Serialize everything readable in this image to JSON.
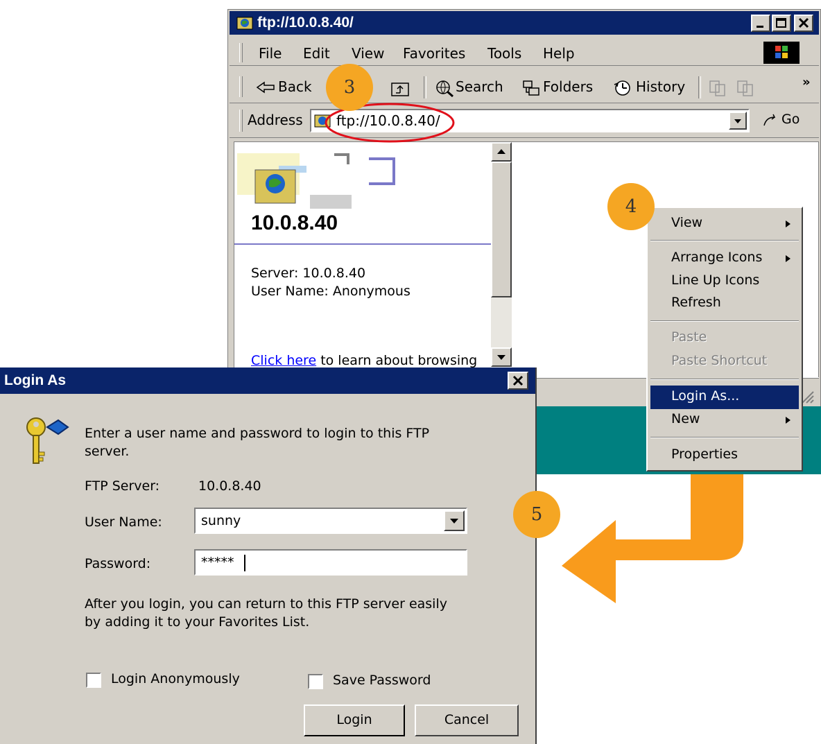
{
  "browser": {
    "title": "ftp://10.0.8.40/",
    "menu": [
      "File",
      "Edit",
      "View",
      "Favorites",
      "Tools",
      "Help"
    ],
    "toolbar": {
      "back": "Back",
      "search": "Search",
      "folders": "Folders",
      "history": "History",
      "more": "»"
    },
    "address": {
      "label": "Address",
      "value": "ftp://10.0.8.40/",
      "go": "Go"
    },
    "panel": {
      "host": "10.0.8.40",
      "server_line": "Server: 10.0.8.40",
      "user_line": "User Name: Anonymous",
      "link": "Click here",
      "link_rest": "to learn about browsing"
    }
  },
  "context_menu": {
    "items": [
      {
        "label": "View",
        "submenu": true,
        "disabled": false
      },
      {
        "label": "Arrange Icons",
        "submenu": true,
        "disabled": false
      },
      {
        "label": "Line Up Icons",
        "submenu": false,
        "disabled": false
      },
      {
        "label": "Refresh",
        "submenu": false,
        "disabled": false
      },
      {
        "label": "Paste",
        "submenu": false,
        "disabled": true
      },
      {
        "label": "Paste Shortcut",
        "submenu": false,
        "disabled": true
      },
      {
        "label": "Login As...",
        "submenu": false,
        "disabled": false,
        "highlighted": true
      },
      {
        "label": "New",
        "submenu": true,
        "disabled": false
      },
      {
        "label": "Properties",
        "submenu": false,
        "disabled": false
      }
    ]
  },
  "dialog": {
    "title": "Login As",
    "intro_1": "Enter a user name and password to login to this FTP",
    "intro_2": "server.",
    "server_label": "FTP Server:",
    "server_value": "10.0.8.40",
    "user_label": "User Name:",
    "user_value": "sunny",
    "password_label": "Password:",
    "password_value": "*****",
    "note_1": "After you login, you can return to this FTP server easily",
    "note_2": "by adding it to your Favorites List.",
    "anon_label": "Login Anonymously",
    "save_label": "Save Password",
    "login_button": "Login",
    "cancel_button": "Cancel",
    "close": "✕"
  },
  "steps": {
    "step3": "3",
    "step4": "4",
    "step5": "5"
  },
  "colors": {
    "titlebar": "#0a246a",
    "face": "#d4d0c8",
    "teal": "#008080",
    "orange": "#f99b1c",
    "highlight_ring": "#e0101a"
  }
}
